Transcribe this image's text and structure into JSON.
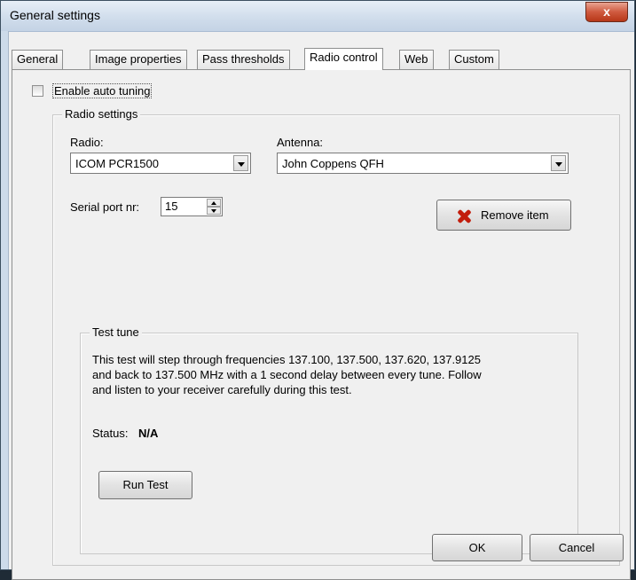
{
  "window": {
    "title": "General settings",
    "close_glyph": "x"
  },
  "tabs": [
    {
      "label": "General"
    },
    {
      "label": "Image properties"
    },
    {
      "label": "Pass thresholds"
    },
    {
      "label": "Radio control",
      "active": true
    },
    {
      "label": "Web"
    },
    {
      "label": "Custom"
    }
  ],
  "auto_tuning": {
    "label": "Enable auto tuning",
    "checked": false
  },
  "radio_settings": {
    "group_title": "Radio settings",
    "radio_label": "Radio:",
    "radio_value": "ICOM PCR1500",
    "antenna_label": "Antenna:",
    "antenna_value": "John Coppens QFH",
    "serial_label": "Serial port nr:",
    "serial_value": "15",
    "remove_label": "Remove item",
    "remove_icon": "red-x-icon"
  },
  "test_tune": {
    "group_title": "Test tune",
    "description_lines": [
      "This test will step through frequencies 137.100, 137.500, 137.620, 137.9125",
      "and back to 137.500 MHz with a 1 second delay between every tune. Follow",
      "and listen to your receiver carefully during this test."
    ],
    "status_label": "Status:",
    "status_value": "N/A",
    "run_label": "Run Test"
  },
  "footer": {
    "ok_label": "OK",
    "cancel_label": "Cancel"
  },
  "colors": {
    "close_button": "#c8492b",
    "remove_icon": "#c21d0c",
    "titlebar": "#cfdceb"
  }
}
